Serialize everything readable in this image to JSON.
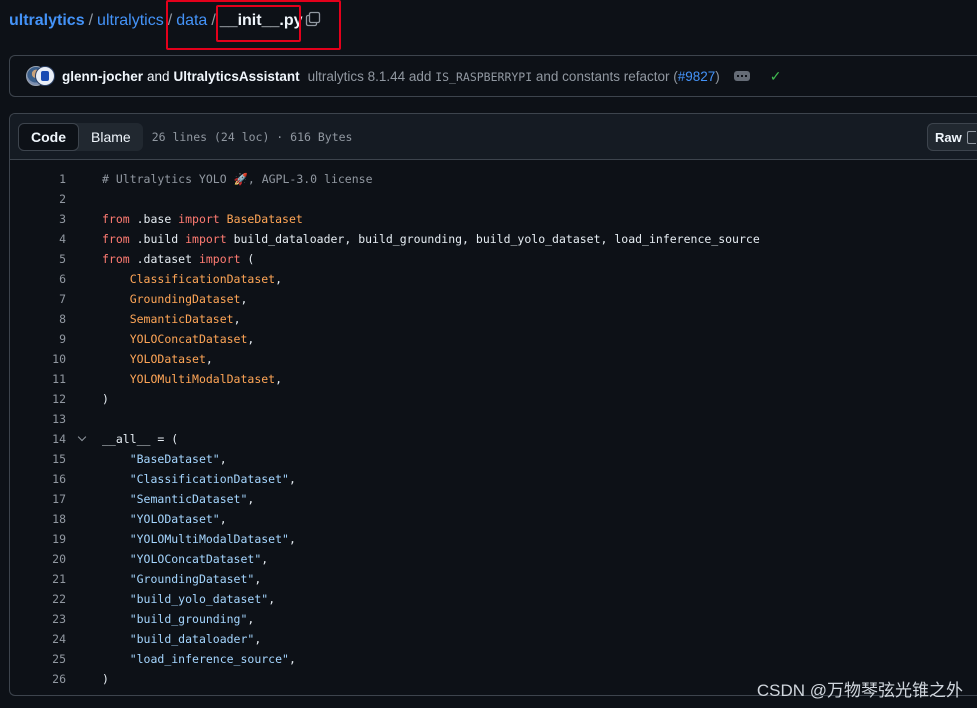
{
  "breadcrumb": {
    "owner": "ultralytics",
    "repo": "ultralytics",
    "folder": "data",
    "separator": "/",
    "file": "__init__.py"
  },
  "commit": {
    "author1": "glenn-jocher",
    "and_text": "and",
    "author2": "UltralyticsAssistant",
    "message_prefix": "ultralytics 8.1.44 add",
    "message_code": "IS_RASPBERRYPI",
    "message_suffix": "and constants refactor (",
    "pr": "#9827",
    "close_paren": ")"
  },
  "file_header": {
    "tab_code": "Code",
    "tab_blame": "Blame",
    "meta": "26 lines (24 loc) · 616 Bytes",
    "raw_label": "Raw"
  },
  "code_lines": [
    {
      "n": "1",
      "t": "# Ultralytics YOLO 🚀, AGPL-3.0 license"
    },
    {
      "n": "2",
      "t": ""
    },
    {
      "n": "3",
      "t": "from .base import BaseDataset"
    },
    {
      "n": "4",
      "t": "from .build import build_dataloader, build_grounding, build_yolo_dataset, load_inference_source"
    },
    {
      "n": "5",
      "t": "from .dataset import ("
    },
    {
      "n": "6",
      "t": "    ClassificationDataset,"
    },
    {
      "n": "7",
      "t": "    GroundingDataset,"
    },
    {
      "n": "8",
      "t": "    SemanticDataset,"
    },
    {
      "n": "9",
      "t": "    YOLOConcatDataset,"
    },
    {
      "n": "10",
      "t": "    YOLODataset,"
    },
    {
      "n": "11",
      "t": "    YOLOMultiModalDataset,"
    },
    {
      "n": "12",
      "t": ")"
    },
    {
      "n": "13",
      "t": ""
    },
    {
      "n": "14",
      "t": "__all__ = ("
    },
    {
      "n": "15",
      "t": "    \"BaseDataset\","
    },
    {
      "n": "16",
      "t": "    \"ClassificationDataset\","
    },
    {
      "n": "17",
      "t": "    \"SemanticDataset\","
    },
    {
      "n": "18",
      "t": "    \"YOLODataset\","
    },
    {
      "n": "19",
      "t": "    \"YOLOMultiModalDataset\","
    },
    {
      "n": "20",
      "t": "    \"YOLOConcatDataset\","
    },
    {
      "n": "21",
      "t": "    \"GroundingDataset\","
    },
    {
      "n": "22",
      "t": "    \"build_yolo_dataset\","
    },
    {
      "n": "23",
      "t": "    \"build_grounding\","
    },
    {
      "n": "24",
      "t": "    \"build_dataloader\","
    },
    {
      "n": "25",
      "t": "    \"load_inference_source\","
    },
    {
      "n": "26",
      "t": ")"
    }
  ],
  "watermark": "CSDN @万物琴弦光锥之外",
  "colors": {
    "background": "#0d1117",
    "link": "#4493f8",
    "keyword": "#ff7b72",
    "class_name": "#ffa657",
    "string": "#a5d6ff",
    "comment": "#9198a1",
    "highlight_box": "#e3001b",
    "success_check": "#3fb950"
  },
  "icons": {
    "copy": "copy-icon",
    "more": "kebab-horizontal-icon",
    "status": "check-icon",
    "fold": "chevron-down-icon"
  }
}
